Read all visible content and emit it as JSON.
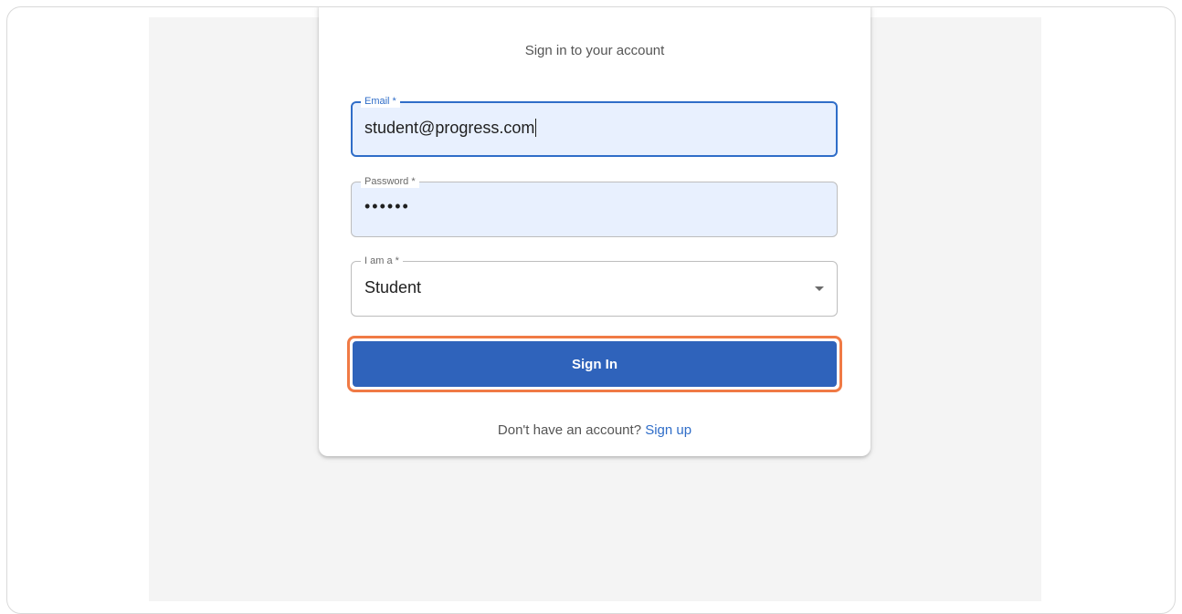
{
  "form": {
    "subtitle": "Sign in to your account",
    "email": {
      "label": "Email *",
      "value": "student@progress.com"
    },
    "password": {
      "label": "Password *",
      "value": "••••••"
    },
    "role": {
      "label": "I am a *",
      "value": "Student"
    },
    "submit_label": "Sign In",
    "footer_text": "Don't have an account?",
    "signup_link": "Sign up"
  },
  "colors": {
    "primary": "#2f63bb",
    "focus": "#2f6dc8",
    "highlight_ring": "#f07a45",
    "autofill_bg": "#e8f0fe"
  }
}
